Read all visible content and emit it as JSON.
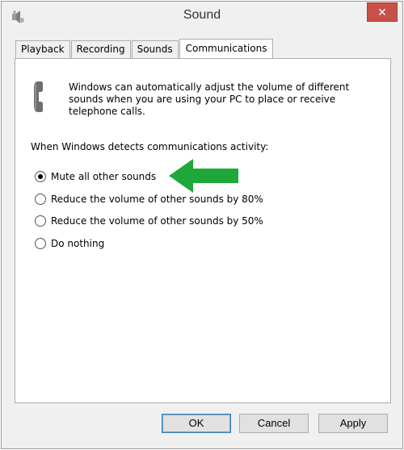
{
  "window": {
    "title": "Sound",
    "close_label": "✕"
  },
  "tabs": [
    {
      "label": "Playback"
    },
    {
      "label": "Recording"
    },
    {
      "label": "Sounds"
    },
    {
      "label": "Communications",
      "active": true
    }
  ],
  "communications": {
    "description": "Windows can automatically adjust the volume of different sounds when you are using your PC to place or receive telephone calls.",
    "prompt": "When Windows detects communications activity:",
    "options": [
      {
        "label": "Mute all other sounds",
        "checked": true
      },
      {
        "label": "Reduce the volume of other sounds by 80%",
        "checked": false
      },
      {
        "label": "Reduce the volume of other sounds by 50%",
        "checked": false
      },
      {
        "label": "Do nothing",
        "checked": false
      }
    ]
  },
  "buttons": {
    "ok": "OK",
    "cancel": "Cancel",
    "apply": "Apply"
  },
  "colors": {
    "arrow": "#1fa83a",
    "close_bg": "#c7504a"
  },
  "icons": {
    "app": "speaker-icon",
    "description": "telephone-handset-icon",
    "annotation": "green-arrow-icon"
  }
}
